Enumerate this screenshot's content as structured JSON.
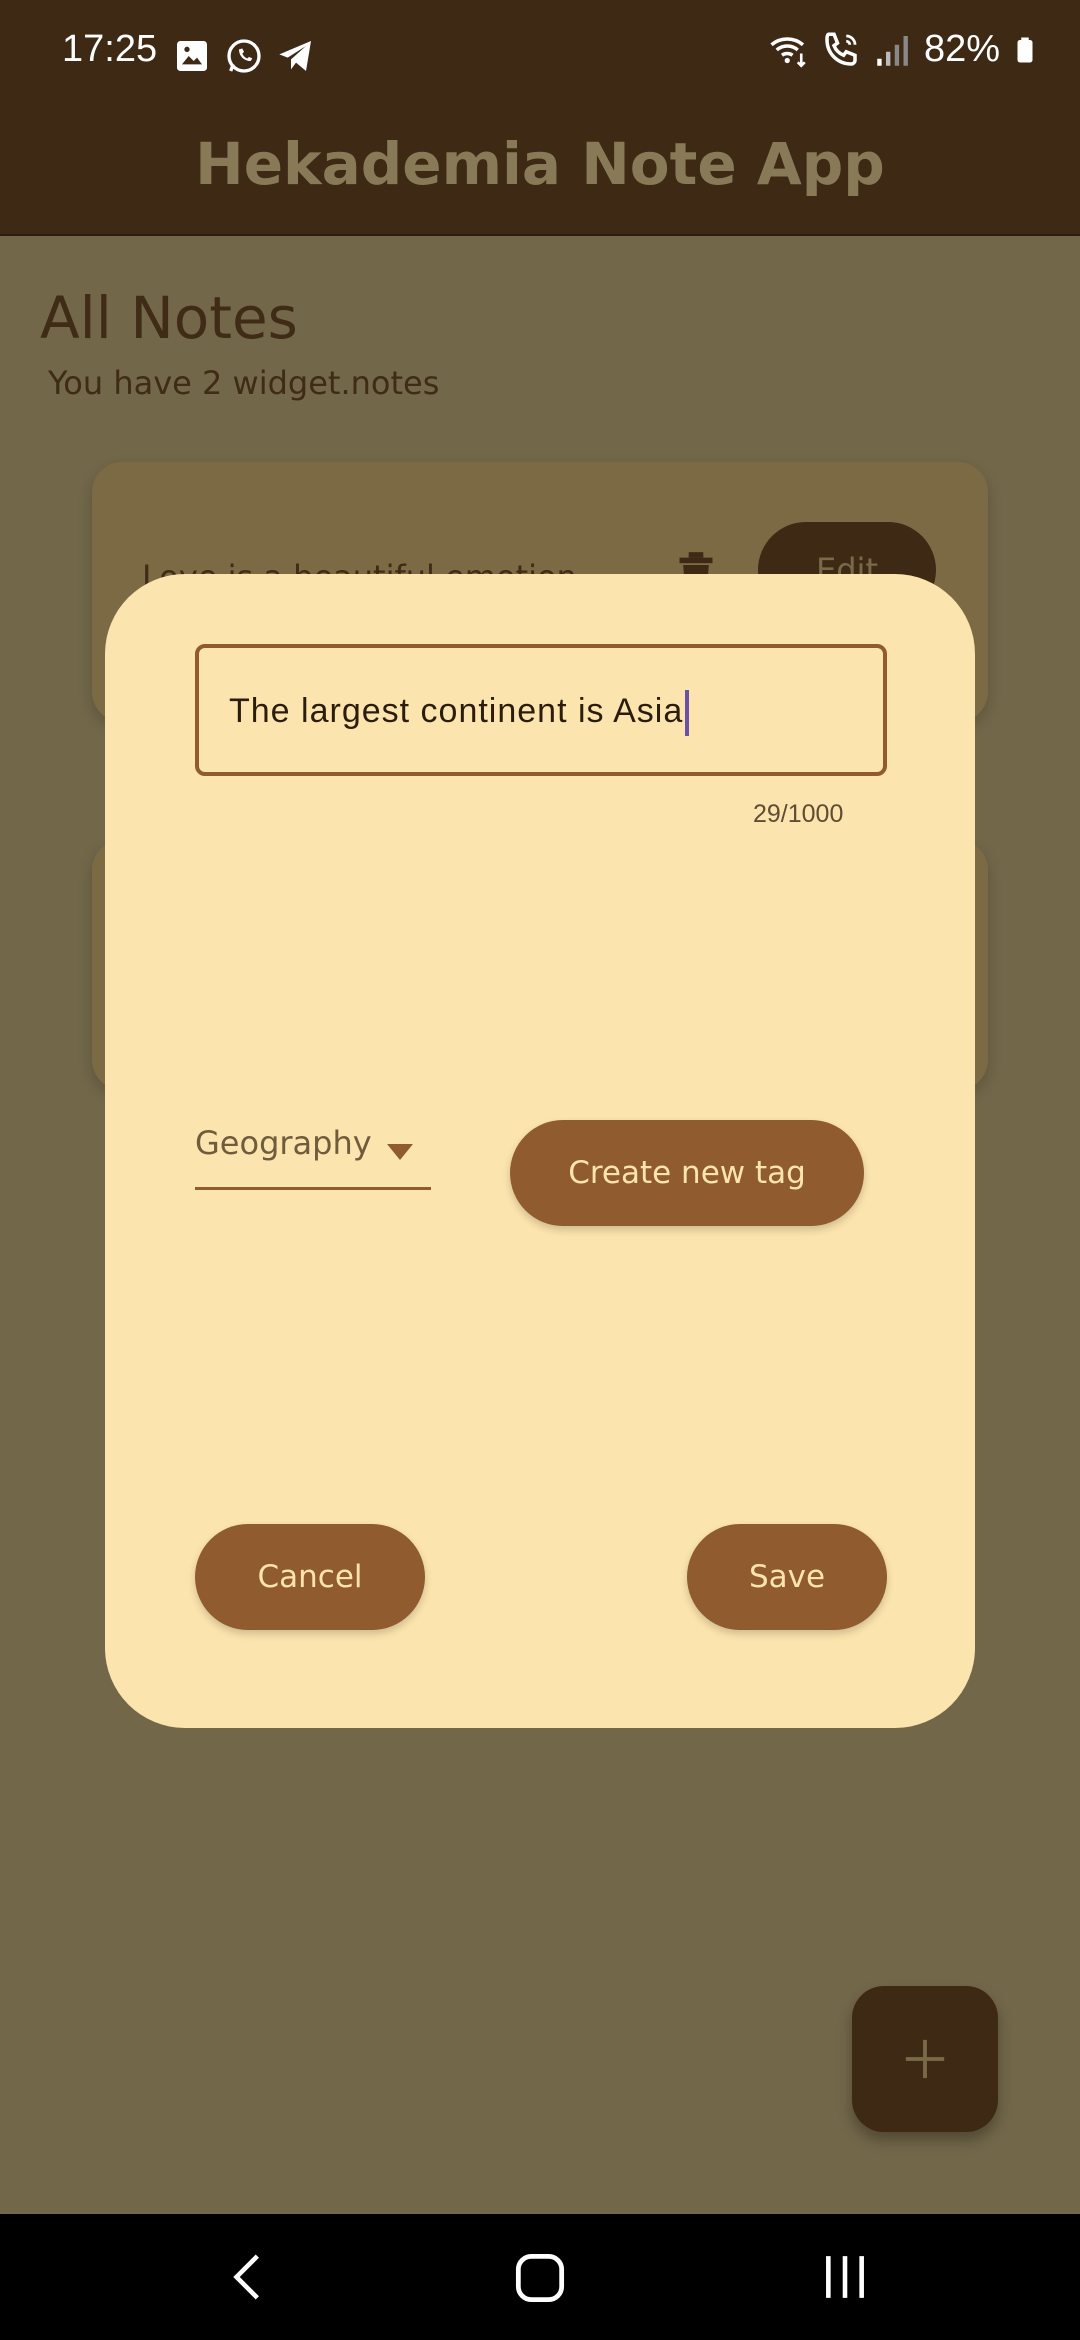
{
  "status_bar": {
    "time": "17:25",
    "battery": "82%",
    "left_icons": [
      "gallery-icon",
      "whatsapp-icon",
      "telegram-icon"
    ],
    "right_icons": [
      "wifi-calling-icon",
      "call-icon",
      "signal-icon",
      "battery-icon"
    ]
  },
  "app_bar": {
    "title": "Hekademia Note App"
  },
  "page": {
    "heading": "All Notes",
    "subtitle": "You have 2 widget.notes"
  },
  "notes": [
    {
      "text": "Love is a beautiful emotion",
      "edit_label": "Edit"
    },
    {
      "text": "",
      "edit_label": ""
    }
  ],
  "dialog": {
    "note_input": {
      "value": "The largest continent is Asia",
      "counter": "29/1000"
    },
    "tag_dropdown": {
      "selected": "Geography"
    },
    "create_tag_label": "Create new tag",
    "cancel_label": "Cancel",
    "save_label": "Save"
  },
  "fab": {
    "icon": "plus-icon"
  },
  "nav_bar": {
    "icons": [
      "back-icon",
      "home-icon",
      "recent-apps-icon"
    ]
  },
  "colors": {
    "app_bar": "#3d2914",
    "scrim_background": "#726749",
    "dialog_background": "#fce4ae",
    "accent_button": "#8f5b2f",
    "caret": "#6a50a7"
  }
}
